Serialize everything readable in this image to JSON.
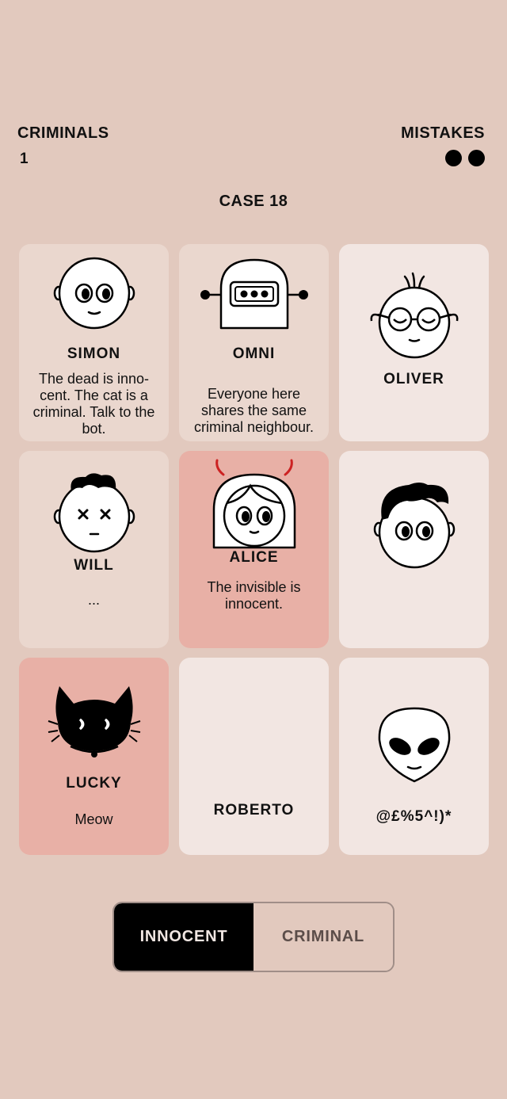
{
  "header": {
    "criminals_label": "CRIMINALS",
    "criminals_count": "1",
    "mistakes_label": "MISTAKES",
    "mistakes_count": 2
  },
  "case_title": "CASE 18",
  "cards": [
    {
      "name": "SIMON",
      "hint": "The dead is inno-cent. The cat is a criminal. Talk to the bot.",
      "status": "innocent",
      "avatar": "face-icon"
    },
    {
      "name": "OMNI",
      "hint": "Everyone here shares the same criminal neighbour.",
      "status": "innocent",
      "avatar": "robot-icon"
    },
    {
      "name": "OLIVER",
      "hint": "",
      "status": "unknown",
      "avatar": "glasses-face-icon"
    },
    {
      "name": "WILL",
      "hint": "...",
      "status": "innocent",
      "avatar": "dead-face-icon"
    },
    {
      "name": "ALICE",
      "hint": "The invisible is innocent.",
      "status": "criminal",
      "avatar": "devil-girl-icon"
    },
    {
      "name": "",
      "hint": "",
      "status": "unknown",
      "avatar": "boy-face-icon"
    },
    {
      "name": "LUCKY",
      "hint": "Meow",
      "status": "criminal",
      "avatar": "cat-icon"
    },
    {
      "name": "ROBERTO",
      "hint": "",
      "status": "unknown",
      "avatar": "none"
    },
    {
      "name": "@£%5^!)*",
      "hint": "",
      "status": "unknown",
      "avatar": "alien-icon"
    }
  ],
  "toggle": {
    "innocent_label": "INNOCENT",
    "criminal_label": "CRIMINAL",
    "selected": "innocent"
  },
  "colors": {
    "background": "#e2c9be",
    "card_revealed": "#ead7ce",
    "card_criminal": "#e8b0a6",
    "card_unknown": "#f2e6e2",
    "devil_horns": "#cc2222"
  }
}
